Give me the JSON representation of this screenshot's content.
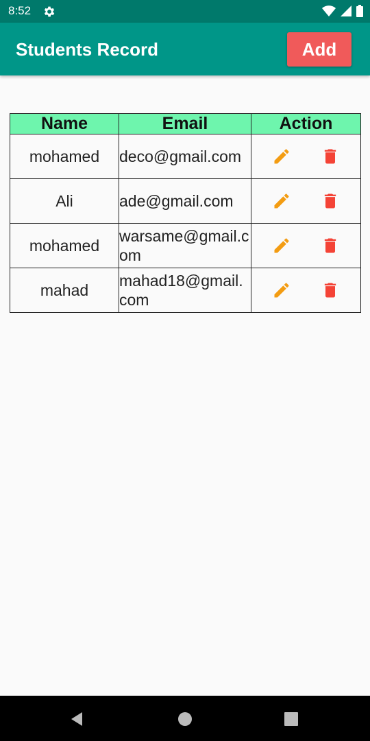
{
  "status_bar": {
    "time": "8:52"
  },
  "app_bar": {
    "title": "Students Record",
    "add_label": "Add"
  },
  "table": {
    "headers": {
      "name": "Name",
      "email": "Email",
      "action": "Action"
    },
    "rows": [
      {
        "name": "mohamed",
        "email": "deco@gmail.com"
      },
      {
        "name": "Ali",
        "email": " ade@gmail.com"
      },
      {
        "name": "mohamed",
        "email": "warsame@gmail.com"
      },
      {
        "name": "mahad",
        "email": "mahad18@gmail.com"
      }
    ]
  },
  "icons": {
    "edit": "edit-icon",
    "delete": "delete-icon",
    "edit_color": "#f39c12",
    "delete_color": "#f44336"
  },
  "colors": {
    "status_bar": "#00796b",
    "app_bar": "#009688",
    "add_button": "#f05a5a",
    "table_header": "#6ef5ad"
  }
}
